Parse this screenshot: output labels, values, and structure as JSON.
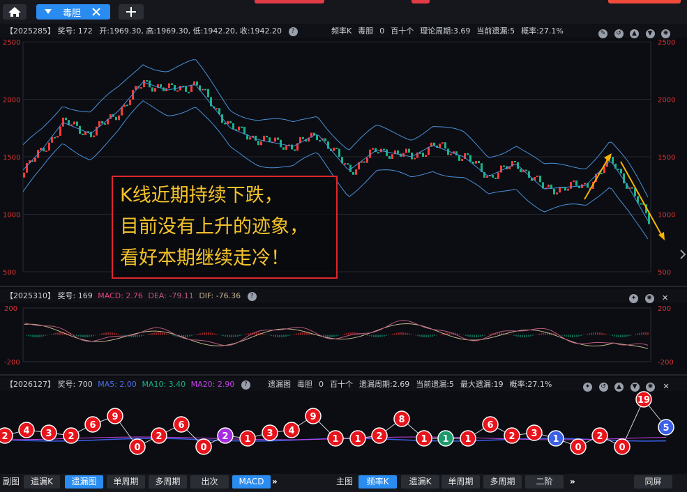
{
  "tabs": {
    "main_label": "毒胆",
    "home_icon": "home-icon",
    "close_icon": "close-icon",
    "add_icon": "plus-icon"
  },
  "colors": {
    "accent": "#2a8cf0",
    "up": "#ff3b3b",
    "down": "#19b38a",
    "band": "#4a90d9",
    "annotation_text": "#f4c22a",
    "annotation_border": "#e0262c"
  },
  "kline_panel": {
    "id": "【2025285】",
    "fields": [
      {
        "label": "奖号:",
        "value": "172"
      },
      {
        "label": "开:",
        "value": "1969.30,"
      },
      {
        "label": "高:",
        "value": "1969.30,"
      },
      {
        "label": "低:",
        "value": "1942.20,"
      },
      {
        "label": "收:",
        "value": "1942.20"
      }
    ],
    "right_info": [
      "频率K",
      "毒胆",
      "0",
      "百十个",
      "理论周期:3.69",
      "当前遗漏:5",
      "概率:27.1%"
    ],
    "yticks": [
      "2500",
      "2000",
      "1500",
      "1000",
      "500"
    ],
    "annotation": [
      "K线近期持续下跌，",
      "目前没有上升的迹象，",
      "看好本期继续走冷！"
    ],
    "arrow_color": "#f4b400"
  },
  "macd_panel": {
    "id": "【2025310】",
    "award_label": "奖号:",
    "award_value": "169",
    "macd": "MACD: 2.76",
    "dea": "DEA: -79.11",
    "dif": "DIF: -76.36",
    "yticks": [
      "200",
      "-200"
    ]
  },
  "miss_panel": {
    "id": "【2026127】",
    "award_label": "奖号:",
    "award_value": "700",
    "ma5": "MA5: 2.00",
    "ma10": "MA10: 3.40",
    "ma20": "MA20: 2.90",
    "right_info": [
      "遗漏图",
      "毒胆",
      "0",
      "百十个",
      "遗漏周期:2.69",
      "当前遗漏:5",
      "最大遗漏:19",
      "概率:27.1%"
    ],
    "points": [
      {
        "v": "2",
        "c": "red"
      },
      {
        "v": "4",
        "c": "red"
      },
      {
        "v": "3",
        "c": "red"
      },
      {
        "v": "2",
        "c": "red"
      },
      {
        "v": "6",
        "c": "red"
      },
      {
        "v": "9",
        "c": "red"
      },
      {
        "v": "0",
        "c": "red"
      },
      {
        "v": "2",
        "c": "red"
      },
      {
        "v": "6",
        "c": "red"
      },
      {
        "v": "0",
        "c": "red"
      },
      {
        "v": "2",
        "c": "purple"
      },
      {
        "v": "1",
        "c": "red"
      },
      {
        "v": "3",
        "c": "red"
      },
      {
        "v": "4",
        "c": "red"
      },
      {
        "v": "9",
        "c": "red"
      },
      {
        "v": "1",
        "c": "red"
      },
      {
        "v": "1",
        "c": "red"
      },
      {
        "v": "2",
        "c": "red"
      },
      {
        "v": "8",
        "c": "red"
      },
      {
        "v": "1",
        "c": "red"
      },
      {
        "v": "1",
        "c": "green"
      },
      {
        "v": "1",
        "c": "red"
      },
      {
        "v": "6",
        "c": "red"
      },
      {
        "v": "2",
        "c": "red"
      },
      {
        "v": "3",
        "c": "red"
      },
      {
        "v": "1",
        "c": "blue"
      },
      {
        "v": "0",
        "c": "red"
      },
      {
        "v": "2",
        "c": "red"
      },
      {
        "v": "0",
        "c": "red"
      },
      {
        "v": "19",
        "c": "red"
      },
      {
        "v": "5",
        "c": "blue"
      }
    ]
  },
  "bottom": {
    "sub_label": "副图",
    "sub_buttons": [
      "遗漏K",
      "遗漏图",
      "单周期",
      "多周期",
      "出次",
      "MACD"
    ],
    "sub_active": [
      1,
      5
    ],
    "main_label": "主图",
    "main_buttons": [
      "频率K",
      "遗漏K",
      "单周期",
      "多周期",
      "二阶"
    ],
    "main_active": [
      0
    ],
    "more": "»",
    "same_screen": "同屏"
  }
}
